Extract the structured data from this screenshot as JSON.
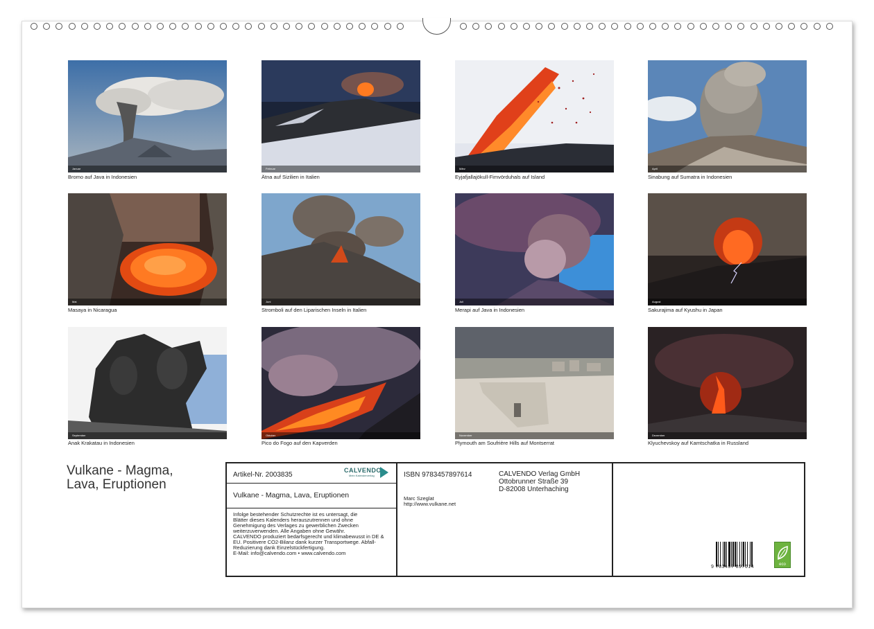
{
  "photos": [
    {
      "caption": "Bromo auf Java in Indonesien",
      "month": "Januar"
    },
    {
      "caption": "Ätna auf Sizilien in Italien",
      "month": "Februar"
    },
    {
      "caption": "Eyjafjallajökull-Fimvörduhals auf Island",
      "month": "März"
    },
    {
      "caption": "Sinabung auf Sumatra in Indonesien",
      "month": "April"
    },
    {
      "caption": "Masaya in Nicaragua",
      "month": "Mai"
    },
    {
      "caption": "Stromboli auf den Liparischen Inseln in Italien",
      "month": "Juni"
    },
    {
      "caption": "Merapi auf Java in Indonesien",
      "month": "Juli"
    },
    {
      "caption": "Sakurajima auf Kyushu in Japan",
      "month": "August"
    },
    {
      "caption": "Anak Krakatau in Indonesien",
      "month": "September"
    },
    {
      "caption": "Pico do Fogo auf den Kapverden",
      "month": "Oktober"
    },
    {
      "caption": "Plymouth am Soufrière Hills auf Montserrat",
      "month": "November"
    },
    {
      "caption": "Klyuchevskoy auf Kamtschatka in Russland",
      "month": "Dezember"
    }
  ],
  "title_line1": "Vulkane - Magma,",
  "title_line2": "Lava, Eruptionen",
  "info": {
    "article": "Artikel-Nr. 2003835",
    "brand": "CALVENDO",
    "brand_sub": "Mein Kalenderverlag",
    "product_title": "Vulkane - Magma, Lava, Eruptionen",
    "legal": [
      "Infolge bestehender Schutzrechte ist es untersagt, die",
      "Blätter dieses Kalenders herauszutrennen und ohne",
      "Genehmigung des Verlages zu gewerblichen Zwecken",
      "weiterzuverwenden. Alle Angaben ohne Gewähr.",
      "CALVENDO produziert bedarfsgerecht und klimabewusst in DE &",
      "EU. Positivere CO2-Bilanz dank kurzer Transportwege. Abfall-",
      "Reduzierung dank Einzelstückfertigung.",
      "E-Mail: info@calvendo.com • www.calvendo.com"
    ],
    "isbn": "ISBN 9783457897614",
    "publisher": [
      "CALVENDO Verlag GmbH",
      "Ottobrunner Straße 39",
      "D-82008 Unterhaching"
    ],
    "author": "Marc Szeglat",
    "author_url": "http://www.vulkane.net",
    "barcode_number": "9 783457 897614",
    "eco": "eco"
  },
  "colors": {
    "frame": "#222222",
    "eco_green": "#6db33f",
    "calvendo_teal": "#2a8c8c"
  }
}
